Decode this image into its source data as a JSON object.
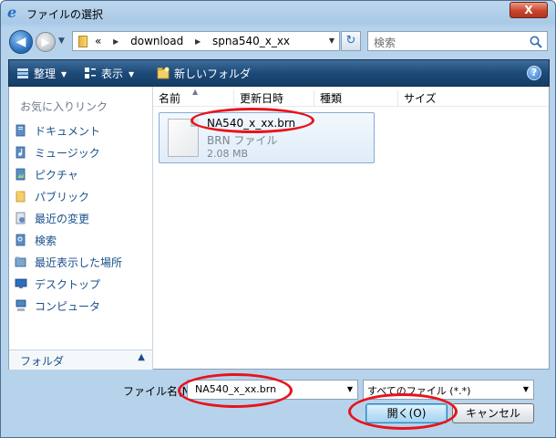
{
  "window": {
    "title": "ファイルの選択",
    "close_label": "X"
  },
  "address": {
    "crumbs": [
      "«",
      "download",
      "spna540_x_xx"
    ],
    "search_placeholder": "検索"
  },
  "toolbar": {
    "organize": "整理",
    "views": "表示",
    "new_folder": "新しいフォルダ",
    "help": "?"
  },
  "navpane": {
    "title": "お気に入りリンク",
    "items": [
      {
        "label": "ドキュメント",
        "icon": "documents-icon"
      },
      {
        "label": "ミュージック",
        "icon": "music-icon"
      },
      {
        "label": "ピクチャ",
        "icon": "pictures-icon"
      },
      {
        "label": "パブリック",
        "icon": "public-folder-icon"
      },
      {
        "label": "最近の変更",
        "icon": "recent-changes-icon"
      },
      {
        "label": "検索",
        "icon": "searches-icon"
      },
      {
        "label": "最近表示した場所",
        "icon": "recent-places-icon"
      },
      {
        "label": "デスクトップ",
        "icon": "desktop-icon"
      },
      {
        "label": "コンピュータ",
        "icon": "computer-icon"
      }
    ],
    "folders_label": "フォルダ"
  },
  "columns": [
    "名前",
    "更新日時",
    "種類",
    "サイズ"
  ],
  "file": {
    "name": "NA540_x_xx.brn",
    "type": "BRN ファイル",
    "size": "2.08 MB"
  },
  "bottom": {
    "filename_label": "ファイル名(N):",
    "filename_value": "NA540_x_xx.brn",
    "filetype_value": "すべてのファイル (*.*)",
    "open_button": "開く(O)",
    "cancel_button": "キャンセル"
  },
  "colors": {
    "highlight_ellipse": "#e8131b",
    "toolbar_bg": "#1d4a78",
    "link_text": "#1a4f8a"
  }
}
